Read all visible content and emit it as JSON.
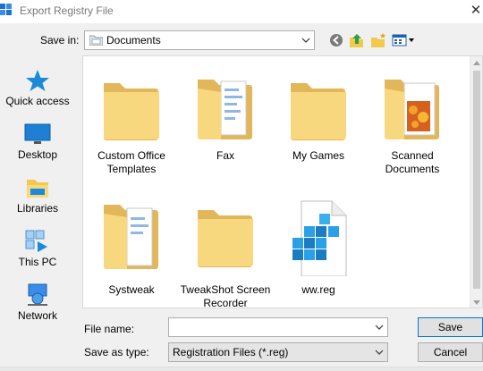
{
  "window": {
    "title": "Export Registry File",
    "close_glyph": "✕",
    "icon": "regedit-icon"
  },
  "toolbar": {
    "save_in_label": "Save in:",
    "location": "Documents",
    "icons": [
      "back-icon",
      "up-folder-icon",
      "new-folder-icon",
      "view-menu-icon"
    ]
  },
  "places": [
    {
      "label": "Quick access",
      "icon": "star-icon"
    },
    {
      "label": "Desktop",
      "icon": "desktop-icon"
    },
    {
      "label": "Libraries",
      "icon": "libraries-icon"
    },
    {
      "label": "This PC",
      "icon": "this-pc-icon"
    },
    {
      "label": "Network",
      "icon": "network-icon"
    }
  ],
  "files": [
    {
      "name": "Custom Office Templates",
      "type": "folder"
    },
    {
      "name": "Fax",
      "type": "folder-with-documents"
    },
    {
      "name": "My Games",
      "type": "folder"
    },
    {
      "name": "Scanned Documents",
      "type": "folder-with-photo"
    },
    {
      "name": "Systweak",
      "type": "folder-with-documents"
    },
    {
      "name": "TweakShot Screen Recorder",
      "type": "folder"
    },
    {
      "name": "ww.reg",
      "type": "registry-file"
    }
  ],
  "form": {
    "file_name_label": "File name:",
    "file_name_value": "",
    "save_as_type_label": "Save as type:",
    "save_as_type_value": "Registration Files (*.reg)"
  },
  "buttons": {
    "save": "Save",
    "cancel": "Cancel"
  },
  "colors": {
    "folder": "#f5d47c",
    "folder_dark": "#e0b651",
    "accent": "#0078d7"
  }
}
